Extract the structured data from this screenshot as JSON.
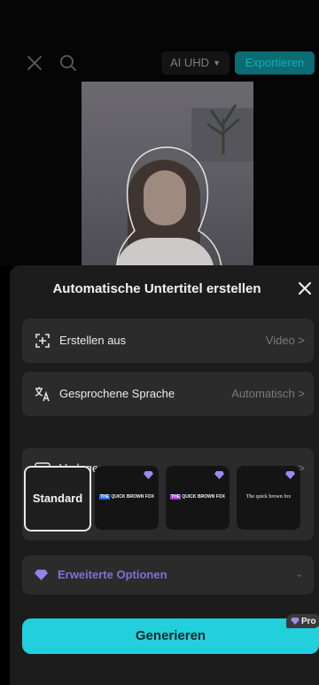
{
  "header": {
    "quality_label": "AI UHD",
    "export_label": "Exportieren"
  },
  "sheet": {
    "title": "Automatische Untertitel erstellen",
    "rows": [
      {
        "label": "Erstellen aus",
        "value": "Video >"
      },
      {
        "label": "Gesprochene Sprache",
        "value": "Automatisch >"
      }
    ],
    "templates": {
      "label": "Vorlagen",
      "chevron": ">",
      "tiles": [
        {
          "label": "Standard"
        },
        {
          "sample_hl": "THE",
          "sample_rest": " QUICK BROWN FOX"
        },
        {
          "sample_hl": "THE",
          "sample_rest": " QUICK BROWN FOX"
        },
        {
          "sample": "The quick brown fox"
        }
      ]
    },
    "advanced": {
      "label": "Erweiterte Optionen"
    },
    "pro_badge": "Pro",
    "generate_label": "Generieren"
  },
  "colors": {
    "accent": "#22d0dc",
    "export_bg": "#0c6b73",
    "premium": "#7d72d8"
  }
}
